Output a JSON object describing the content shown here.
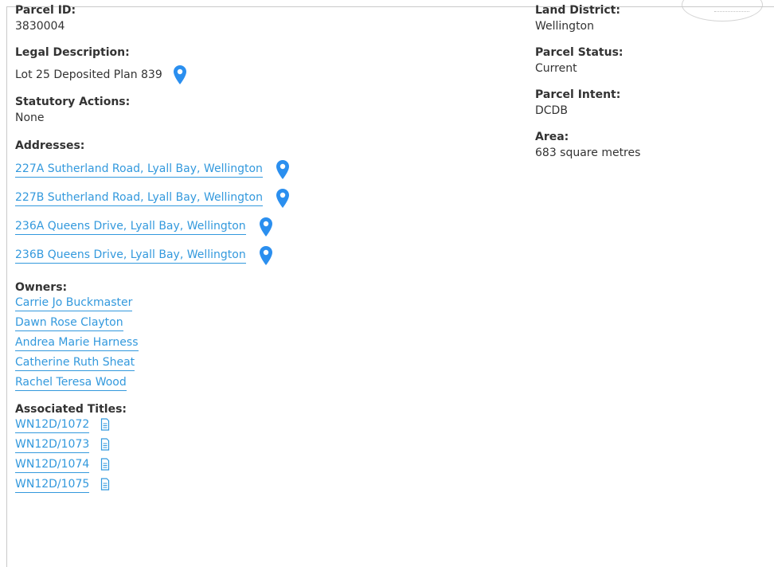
{
  "left": {
    "parcel_id": {
      "label": "Parcel ID:",
      "value": "3830004"
    },
    "legal_description": {
      "label": "Legal Description:",
      "value": "Lot 25 Deposited Plan 839"
    },
    "statutory_actions": {
      "label": "Statutory Actions:",
      "value": "None"
    },
    "addresses": {
      "label": "Addresses:",
      "items": [
        "227A Sutherland Road, Lyall Bay, Wellington",
        "227B Sutherland Road, Lyall Bay, Wellington",
        "236A Queens Drive, Lyall Bay, Wellington",
        "236B Queens Drive, Lyall Bay, Wellington"
      ]
    },
    "owners": {
      "label": "Owners:",
      "items": [
        "Carrie Jo Buckmaster",
        "Dawn Rose Clayton",
        "Andrea Marie Harness",
        "Catherine Ruth Sheat",
        "Rachel Teresa Wood"
      ]
    },
    "associated_titles": {
      "label": "Associated Titles:",
      "items": [
        "WN12D/1072",
        "WN12D/1073",
        "WN12D/1074",
        "WN12D/1075"
      ]
    }
  },
  "right": {
    "land_district": {
      "label": "Land District:",
      "value": "Wellington"
    },
    "parcel_status": {
      "label": "Parcel Status:",
      "value": "Current"
    },
    "parcel_intent": {
      "label": "Parcel Intent:",
      "value": "DCDB"
    },
    "area": {
      "label": "Area:",
      "value": "683 square metres"
    }
  },
  "colors": {
    "link": "#3399dd",
    "pin": "#2b8fef",
    "text": "#333333"
  },
  "icons": {
    "map_pin": "map-pin-icon",
    "document": "document-icon"
  }
}
